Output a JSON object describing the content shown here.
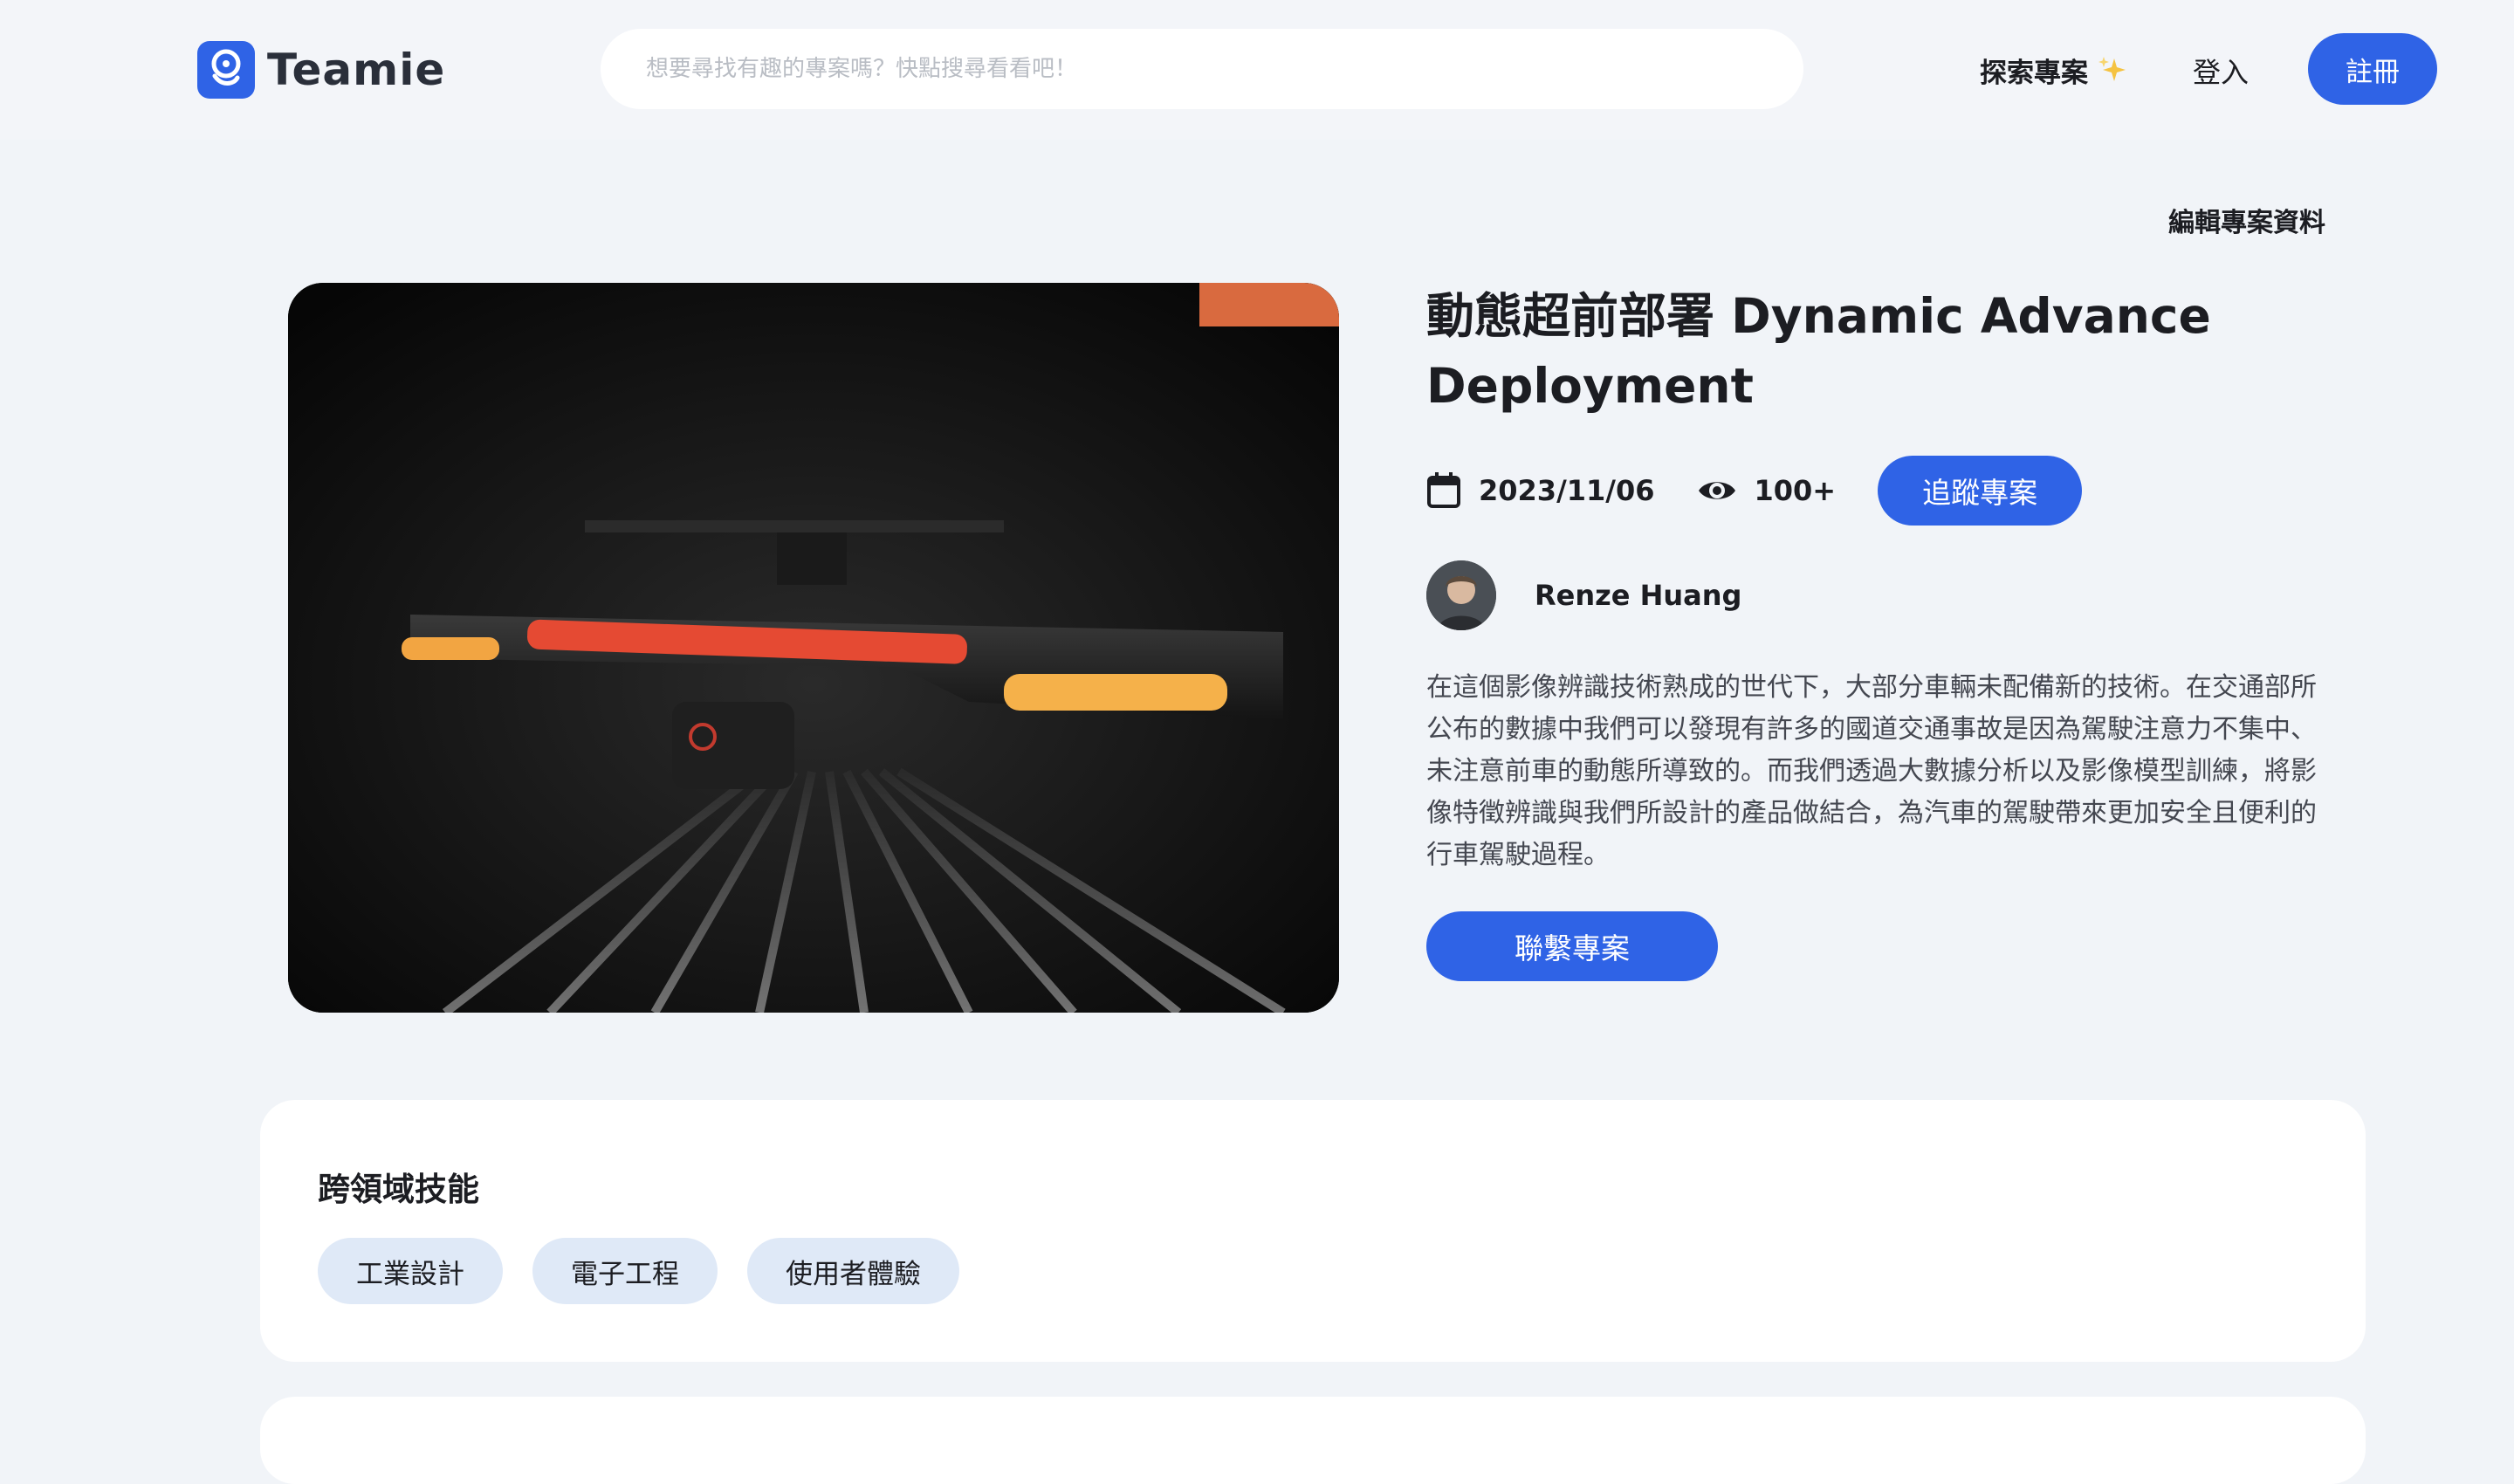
{
  "header": {
    "logo_text": "Teamie",
    "search_placeholder": "想要尋找有趣的專案嗎？快點搜尋看看吧！",
    "nav_explore": "探索專案",
    "nav_login": "登入",
    "register_label": "註冊"
  },
  "edit_link": "編輯專案資料",
  "project": {
    "title": "動態超前部署 Dynamic Advance Deployment",
    "date": "2023/11/06",
    "views": "100+",
    "follow_label": "追蹤專案",
    "author_name": "Renze Huang",
    "description": "在這個影像辨識技術熟成的世代下，大部分車輛未配備新的技術。在交通部所公布的數據中我們可以發現有許多的國道交通事故是因為駕駛注意力不集中、未注意前車的動態所導致的。而我們透過大數據分析以及影像模型訓練，將影像特徵辨識與我們所設計的產品做結合，為汽車的駕駛帶來更加安全且便利的行車駕駛過程。",
    "contact_label": "聯繫專案"
  },
  "skills": {
    "title": "跨領域技能",
    "tags": [
      "工業設計",
      "電子工程",
      "使用者體驗"
    ]
  },
  "colors": {
    "primary": "#2f63e6",
    "tag_bg": "#dfe9f7",
    "page_bg": "#f1f4f8",
    "accent_orange": "#d96a3f"
  },
  "icons": {
    "calendar": "calendar-icon",
    "views": "eye-icon",
    "explore": "sparkle-icon"
  }
}
